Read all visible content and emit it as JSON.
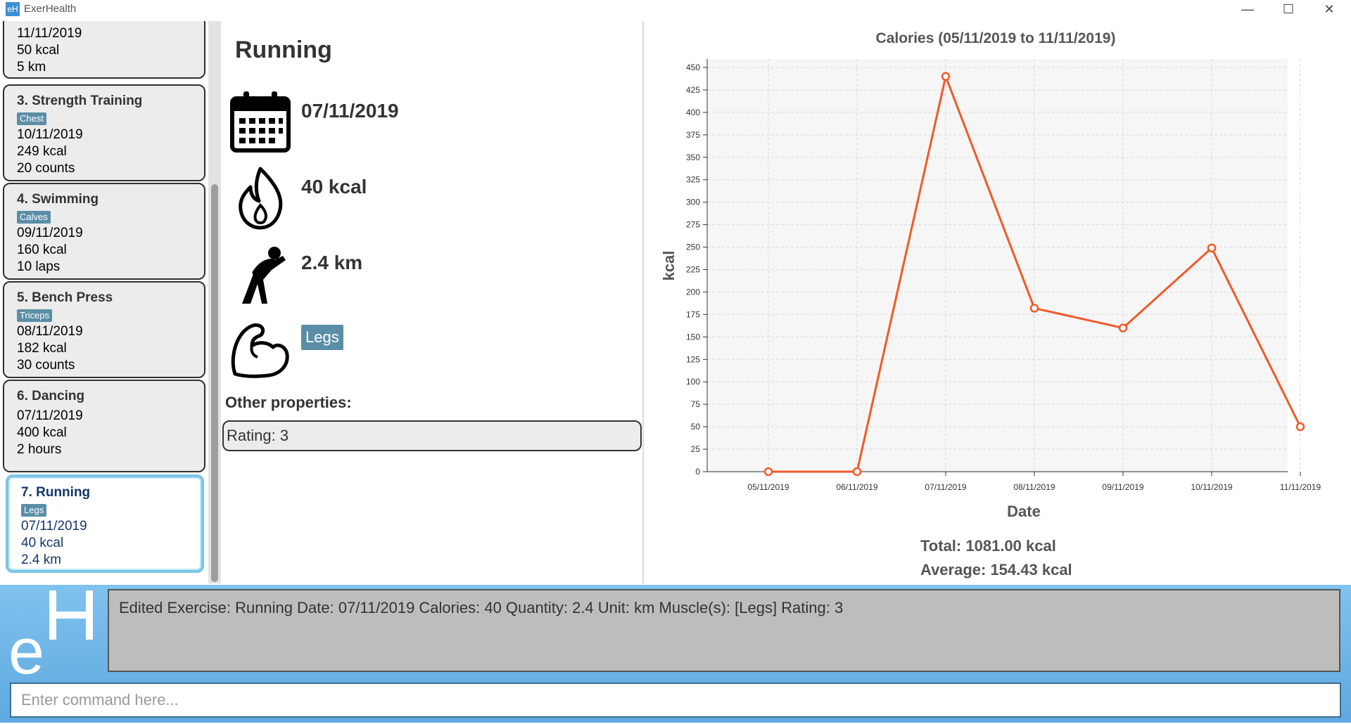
{
  "window": {
    "title": "ExerHealth"
  },
  "exercise_list": [
    {
      "title": "",
      "tag": "",
      "date": "11/11/2019",
      "calories": "50 kcal",
      "quantity": "5 km"
    },
    {
      "title": "3.  Strength Training",
      "tag": "Chest",
      "date": "10/11/2019",
      "calories": "249 kcal",
      "quantity": "20 counts"
    },
    {
      "title": "4.  Swimming",
      "tag": "Calves",
      "date": "09/11/2019",
      "calories": "160 kcal",
      "quantity": "10 laps"
    },
    {
      "title": "5.  Bench Press",
      "tag": "Triceps",
      "date": "08/11/2019",
      "calories": "182 kcal",
      "quantity": "30 counts"
    },
    {
      "title": "6.  Dancing",
      "tag": "",
      "date": "07/11/2019",
      "calories": "400 kcal",
      "quantity": "2 hours"
    },
    {
      "title": "7.  Running",
      "tag": "Legs",
      "date": "07/11/2019",
      "calories": "40 kcal",
      "quantity": "2.4 km"
    }
  ],
  "detail": {
    "name": "Running",
    "date": "07/11/2019",
    "calories": "40 kcal",
    "quantity": "2.4 km",
    "muscle": "Legs",
    "other_label": "Other properties:",
    "rating": "Rating: 3"
  },
  "chart_data": {
    "type": "line",
    "title": "Calories (05/11/2019 to 11/11/2019)",
    "xlabel": "Date",
    "ylabel": "kcal",
    "ylim": [
      0,
      450
    ],
    "yticks": [
      0,
      25,
      50,
      75,
      100,
      125,
      150,
      175,
      200,
      225,
      250,
      275,
      300,
      325,
      350,
      375,
      400,
      425,
      450
    ],
    "categories": [
      "05/11/2019",
      "06/11/2019",
      "07/11/2019",
      "08/11/2019",
      "09/11/2019",
      "10/11/2019",
      "11/11/2019"
    ],
    "values": [
      0,
      0,
      440,
      182,
      160,
      249,
      50
    ],
    "color": "#f05a28",
    "grid": true
  },
  "stats": {
    "total": "Total: 1081.00 kcal",
    "average": "Average: 154.43 kcal"
  },
  "result_text": "Edited Exercise: Running Date: 07/11/2019 Calories: 40 Quantity: 2.4 Unit: km Muscle(s): [Legs] Rating: 3",
  "command": {
    "placeholder": "Enter command here...",
    "value": ""
  }
}
